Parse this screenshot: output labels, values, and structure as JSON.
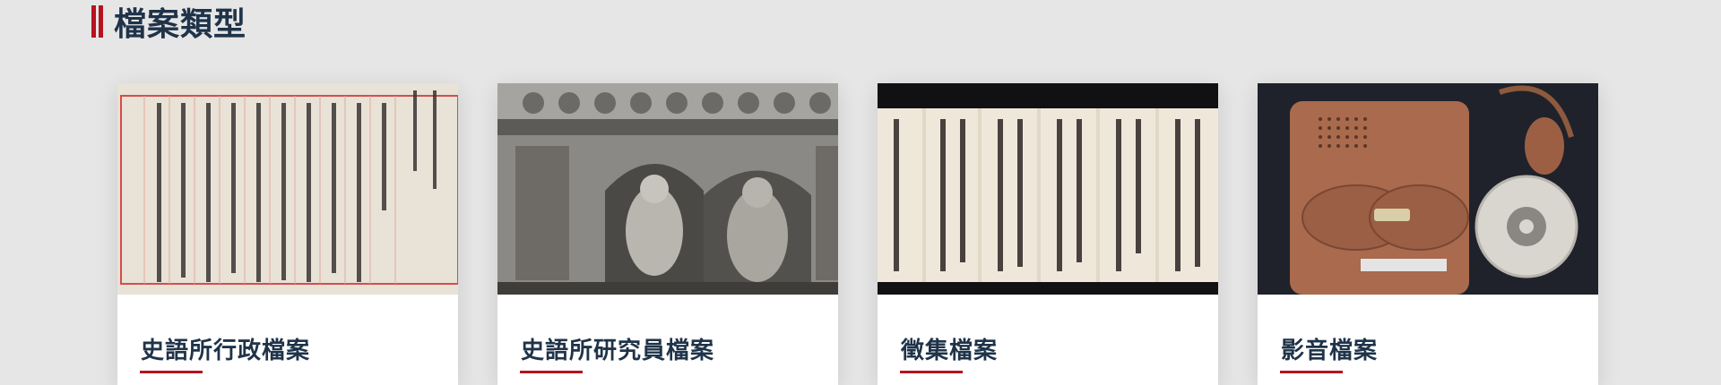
{
  "section": {
    "title": "檔案類型"
  },
  "colors": {
    "accent": "#b7131f",
    "title": "#1f3349",
    "background": "#e6e6e6",
    "card": "#ffffff"
  },
  "cards": [
    {
      "label": "史語所行政檔案",
      "image": "handwritten-letter-image"
    },
    {
      "label": "史語所研究員檔案",
      "image": "cave-buddha-relief-image"
    },
    {
      "label": "徵集檔案",
      "image": "calligraphy-scroll-image"
    },
    {
      "label": "影音檔案",
      "image": "tape-recorder-image"
    }
  ]
}
